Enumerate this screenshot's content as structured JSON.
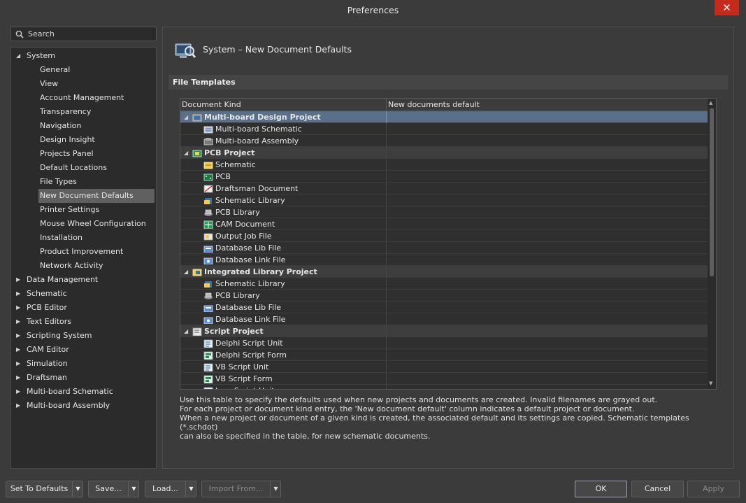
{
  "window": {
    "title": "Preferences",
    "close_glyph": "✕"
  },
  "search": {
    "placeholder": "Search"
  },
  "tree": {
    "system_label": "System",
    "system_children": [
      "General",
      "View",
      "Account Management",
      "Transparency",
      "Navigation",
      "Design Insight",
      "Projects Panel",
      "Default Locations",
      "File Types",
      "New Document Defaults",
      "Printer Settings",
      "Mouse Wheel Configuration",
      "Installation",
      "Product Improvement",
      "Network Activity"
    ],
    "selected": "New Document Defaults",
    "collapsed": [
      "Data Management",
      "Schematic",
      "PCB Editor",
      "Text Editors",
      "Scripting System",
      "CAM Editor",
      "Simulation",
      "Draftsman",
      "Multi-board Schematic",
      "Multi-board Assembly"
    ]
  },
  "page": {
    "title": "System – New Document Defaults",
    "section": "File Templates"
  },
  "grid": {
    "col_kind": "Document Kind",
    "col_default": "New documents default",
    "rows": [
      {
        "name": "Multi-board Design Project",
        "project": true,
        "selected": true,
        "icon": "multiboard-project-icon"
      },
      {
        "name": "Multi-board Schematic",
        "icon": "multiboard-schematic-icon"
      },
      {
        "name": "Multi-board Assembly",
        "icon": "multiboard-assembly-icon"
      },
      {
        "name": "PCB Project",
        "project": true,
        "icon": "pcb-project-icon"
      },
      {
        "name": "Schematic",
        "icon": "schematic-icon"
      },
      {
        "name": "PCB",
        "icon": "pcb-icon"
      },
      {
        "name": "Draftsman Document",
        "icon": "draftsman-icon"
      },
      {
        "name": "Schematic Library",
        "icon": "schematic-library-icon"
      },
      {
        "name": "PCB Library",
        "icon": "pcb-library-icon"
      },
      {
        "name": "CAM Document",
        "icon": "cam-document-icon"
      },
      {
        "name": "Output Job File",
        "icon": "output-job-icon"
      },
      {
        "name": "Database Lib File",
        "icon": "database-lib-icon"
      },
      {
        "name": "Database Link File",
        "icon": "database-link-icon"
      },
      {
        "name": "Integrated Library Project",
        "project": true,
        "icon": "integrated-library-icon"
      },
      {
        "name": "Schematic Library",
        "icon": "schematic-library-icon"
      },
      {
        "name": "PCB Library",
        "icon": "pcb-library-icon"
      },
      {
        "name": "Database Lib File",
        "icon": "database-lib-icon"
      },
      {
        "name": "Database Link File",
        "icon": "database-link-icon"
      },
      {
        "name": "Script Project",
        "project": true,
        "icon": "script-project-icon"
      },
      {
        "name": "Delphi Script Unit",
        "icon": "script-unit-icon"
      },
      {
        "name": "Delphi Script Form",
        "icon": "script-form-icon"
      },
      {
        "name": "VB Script Unit",
        "icon": "script-unit-icon"
      },
      {
        "name": "VB Script Form",
        "icon": "script-form-icon"
      },
      {
        "name": "Java Script Unit",
        "icon": "script-unit-icon"
      }
    ]
  },
  "description": [
    "Use this table to specify the defaults used when new projects and documents are created. Invalid filenames are grayed out.",
    "For each project or document kind entry, the 'New document default' column indicates a default project or document.",
    "When a new project or document of a given kind is created, the associated default and its settings are copied. Schematic templates (*.schdot)",
    "can also be specified in the table, for new schematic documents."
  ],
  "buttons": {
    "set_defaults": "Set To Defaults",
    "save": "Save...",
    "load": "Load...",
    "import_from": "Import From...",
    "ok": "OK",
    "cancel": "Cancel",
    "apply": "Apply"
  },
  "colors": {
    "accent_close": "#c42b1c",
    "selected_row": "#5a6f8a",
    "panel": "#2b2b2b"
  }
}
